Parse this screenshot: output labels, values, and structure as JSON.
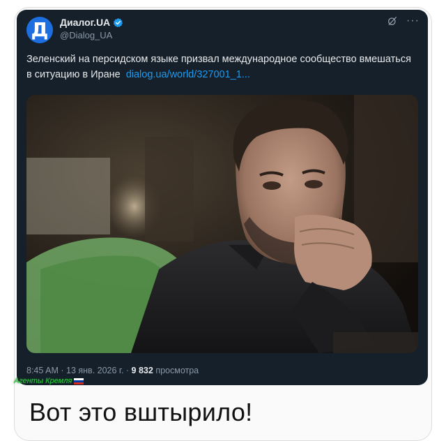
{
  "tweet": {
    "avatar_letter": "Д",
    "display_name": "Диалог.UA",
    "handle": "@Dialog_UA",
    "text": "Зеленский на персидском языке призвал международное сообщество вмешаться в ситуацию в Иране",
    "link": "dialog.ua/world/327001_1...",
    "time": "8:45 AM",
    "date": "13 янв. 2026 г.",
    "views_count": "9 832",
    "views_label": "просмотра",
    "more_label": "···"
  },
  "watermark": {
    "text": "Агенты Кремля"
  },
  "caption": "Вот это вштырило!",
  "colors": {
    "tweet_bg": "#15202b",
    "link": "#1d9bf0",
    "verified": "#1d9bf0",
    "watermark": "#2ecc40"
  },
  "icons": {
    "verified": "verified-badge-icon",
    "grok": "grok-icon",
    "more": "more-icon"
  }
}
